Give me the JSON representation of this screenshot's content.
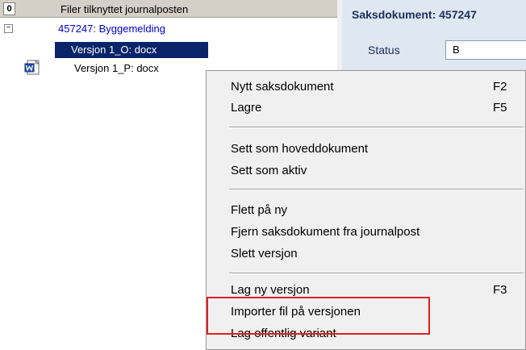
{
  "tree": {
    "header_badge": "0",
    "header_label": "Filer tilknyttet journalposten",
    "expander": "−",
    "nodes": {
      "document": "457247: Byggemelding",
      "version_o": "Versjon 1_O: docx",
      "version_p": "Versjon 1_P: docx"
    }
  },
  "detail": {
    "title": "Saksdokument: 457247",
    "status_label": "Status",
    "status_value": "B"
  },
  "context_menu": {
    "items": [
      {
        "label": "Nytt saksdokument",
        "shortcut": "F2"
      },
      {
        "label": "Lagre",
        "shortcut": "F5"
      },
      {
        "label": "Sett som hoveddokument",
        "shortcut": ""
      },
      {
        "label": "Sett som aktiv",
        "shortcut": ""
      },
      {
        "label": "Flett på ny",
        "shortcut": ""
      },
      {
        "label": "Fjern saksdokument fra journalpost",
        "shortcut": ""
      },
      {
        "label": "Slett versjon",
        "shortcut": ""
      },
      {
        "label": "Lag ny versjon",
        "shortcut": "F3"
      },
      {
        "label": "Importer fil på versjonen",
        "shortcut": ""
      },
      {
        "label": "Lag offentlig variant",
        "shortcut": ""
      }
    ]
  },
  "colors": {
    "selection": "#0a246a",
    "link": "#0000cc",
    "highlight_box": "#e02020",
    "detail_bg": "#dfe7f1"
  }
}
